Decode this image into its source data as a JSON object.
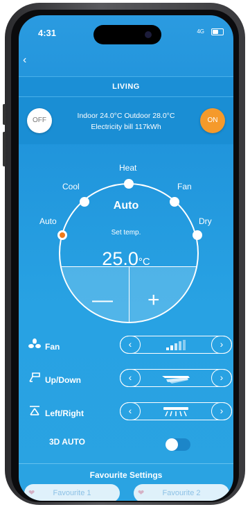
{
  "status_bar": {
    "time": "4:31",
    "network": "4G"
  },
  "header": {
    "back_glyph": "‹",
    "title": "LIVING"
  },
  "power": {
    "off_label": "OFF",
    "on_label": "ON",
    "accent_color": "#f59a2b"
  },
  "info": {
    "line1": "Indoor 24.0°C Outdoor 28.0°C",
    "line2": "Electricity bill 117kWh"
  },
  "modes": {
    "heat": "Heat",
    "cool": "Cool",
    "fan": "Fan",
    "auto": "Auto",
    "dry": "Dry",
    "selected": "Auto"
  },
  "dial": {
    "current_mode": "Auto",
    "set_temp_label": "Set temp.",
    "temp_value": "25.0",
    "temp_unit": "°C",
    "minus_glyph": "—",
    "plus_glyph": "+"
  },
  "controls": {
    "fan": {
      "label": "Fan",
      "icon": "fan-icon"
    },
    "updown": {
      "label": "Up/Down",
      "icon": "vane-updown-icon"
    },
    "leftright": {
      "label": "Left/Right",
      "icon": "vane-leftright-icon"
    },
    "arrow_left": "‹",
    "arrow_right": "›"
  },
  "auto3d": {
    "label": "3D AUTO",
    "enabled": false
  },
  "favourites": {
    "title": "Favourite Settings",
    "items": [
      "Favourite 1",
      "Favourite 2"
    ]
  }
}
